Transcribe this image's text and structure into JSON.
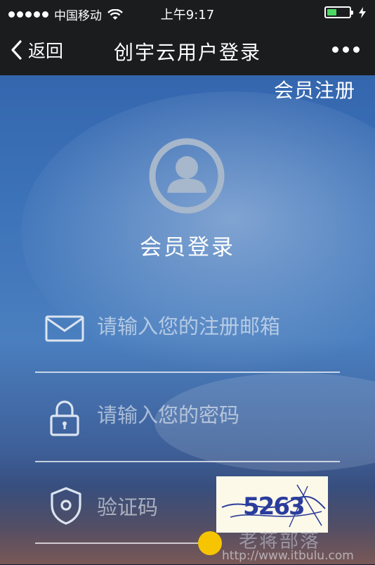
{
  "status_bar": {
    "carrier": "中国移动",
    "time": "上午9:17",
    "battery_level": 0.45,
    "signal_dots": 5
  },
  "nav": {
    "back_label": "返回",
    "title": "创宇云用户登录"
  },
  "page": {
    "register_link": "会员注册",
    "login_title": "会员登录"
  },
  "form": {
    "email_placeholder": "请输入您的注册邮箱",
    "password_placeholder": "请输入您的密码",
    "captcha_placeholder": "验证码",
    "captcha_text": "5263"
  },
  "watermark": {
    "name": "老蒋部落",
    "url": "http://www.itbulu.com"
  },
  "colors": {
    "nav_bg": "#1b1c1e",
    "battery_fill": "#4cd964",
    "captcha_bg": "#fdf9e9",
    "captcha_ink": "#2a3c9c"
  }
}
